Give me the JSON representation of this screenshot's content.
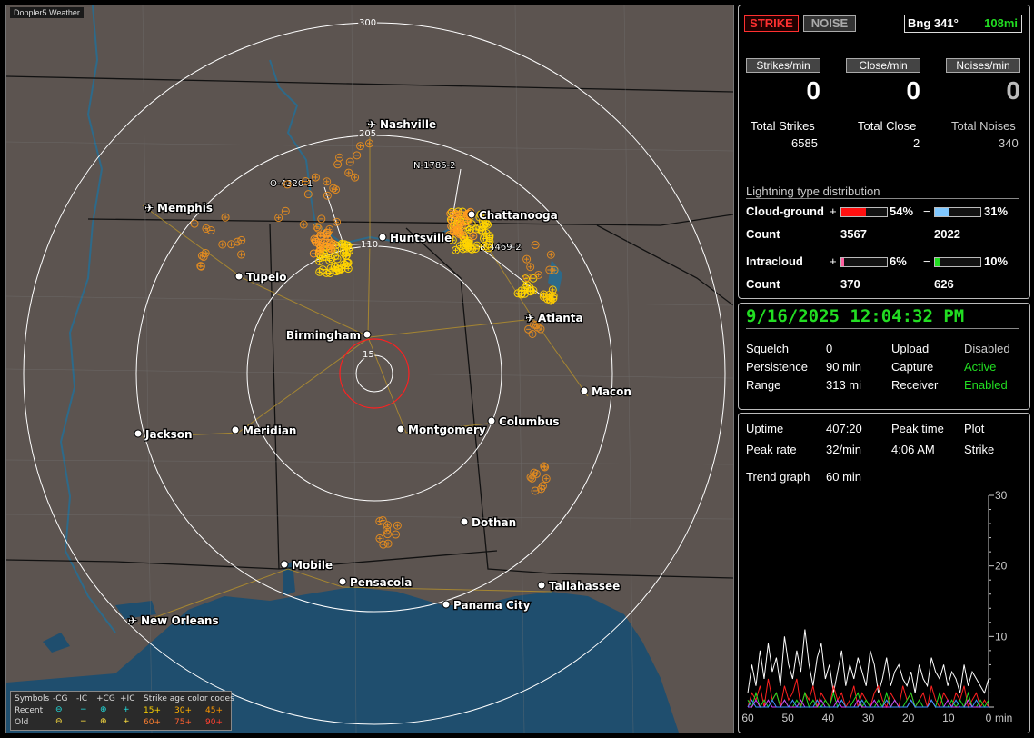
{
  "app_tag": "Doppler5 Weather",
  "map": {
    "ring_labels": [
      "300",
      "205",
      "110",
      "15"
    ],
    "cities": [
      "Nashville",
      "Memphis",
      "Chattanooga",
      "Huntsville",
      "Tupelo",
      "Birmingham",
      "Atlanta",
      "Macon",
      "Jackson",
      "Meridian",
      "Montgomery",
      "Columbus",
      "Dothan",
      "Mobile",
      "Pensacola",
      "Tallahassee",
      "Panama City",
      "New Orleans"
    ],
    "storm_labels": [
      "N-1786-2",
      "O-4320-1",
      "R-4469-2"
    ],
    "colors": {
      "land": "#5c5450",
      "water": "#1f4e6e",
      "rings": "#ffffff",
      "close_ring": "#ff2020",
      "recent": "#ffd400",
      "old": "#e08a20"
    }
  },
  "legend": {
    "symbols_title": "Symbols",
    "headers": [
      "-CG",
      "-IC",
      "+CG",
      "+IC"
    ],
    "recent_label": "Recent",
    "old_label": "Old",
    "age_title": "Strike age color codes",
    "recent_ages": [
      "15+",
      "30+",
      "45+"
    ],
    "old_ages": [
      "60+",
      "75+",
      "90+"
    ]
  },
  "panel1": {
    "strike_tab": "STRIKE",
    "noise_tab": "NOISE",
    "bearing": "Bng 341°",
    "distance": "108mi",
    "rate_buttons": [
      "Strikes/min",
      "Close/min",
      "Noises/min"
    ],
    "rate_values": [
      "0",
      "0",
      "0"
    ],
    "totals_labels": [
      "Total Strikes",
      "Total Close",
      "Total Noises"
    ],
    "totals_values": [
      "6585",
      "2",
      "340"
    ],
    "dist_title": "Lightning type distribution",
    "cg_label": "Cloud-ground",
    "cg_pos_pct": "54%",
    "cg_neg_pct": "31%",
    "cg_pos_fill": 0.54,
    "cg_neg_fill": 0.31,
    "count_label": "Count",
    "cg_pos_count": "3567",
    "cg_neg_count": "2022",
    "ic_label": "Intracloud",
    "ic_pos_pct": "6%",
    "ic_neg_pct": "10%",
    "ic_pos_fill": 0.06,
    "ic_neg_fill": 0.1,
    "ic_pos_count": "370",
    "ic_neg_count": "626"
  },
  "panel2": {
    "datetime": "9/16/2025 12:04:32 PM",
    "squelch_label": "Squelch",
    "squelch_value": "0",
    "upload_label": "Upload",
    "upload_value": "Disabled",
    "persistence_label": "Persistence",
    "persistence_value": "90 min",
    "capture_label": "Capture",
    "capture_value": "Active",
    "range_label": "Range",
    "range_value": "313 mi",
    "receiver_label": "Receiver",
    "receiver_value": "Enabled"
  },
  "panel3": {
    "uptime_label": "Uptime",
    "uptime_value": "407:20",
    "peak_time_label": "Peak time",
    "plot_label": "Plot",
    "peak_rate_label": "Peak rate",
    "peak_rate_value": "32/min",
    "peak_time_value": "4:06 AM",
    "plot_value": "Strike",
    "trend_label": "Trend graph",
    "trend_value": "60 min",
    "x_ticks": [
      "60",
      "50",
      "40",
      "30",
      "20",
      "10",
      "0"
    ],
    "x_unit": "min",
    "y_ticks": [
      "30",
      "20",
      "10"
    ]
  },
  "chart_data": {
    "type": "line",
    "xlabel": "min",
    "ylim": [
      0,
      30
    ],
    "xlim": [
      60,
      0
    ],
    "series": [
      {
        "color": "#ffffff",
        "values": [
          2,
          6,
          3,
          8,
          4,
          9,
          5,
          7,
          3,
          10,
          6,
          4,
          8,
          5,
          11,
          6,
          3,
          7,
          9,
          4,
          6,
          2,
          5,
          8,
          3,
          6,
          4,
          7,
          5,
          3,
          8,
          6,
          2,
          4,
          7,
          3,
          5,
          6,
          4,
          3,
          5,
          2,
          6,
          4,
          3,
          7,
          5,
          4,
          6,
          3,
          5,
          4,
          2,
          6,
          3,
          5,
          4,
          3,
          2,
          4
        ]
      },
      {
        "color": "#ff2020",
        "values": [
          0,
          2,
          1,
          3,
          0,
          4,
          1,
          2,
          0,
          3,
          1,
          2,
          4,
          0,
          2,
          1,
          3,
          0,
          2,
          1,
          0,
          3,
          1,
          2,
          0,
          1,
          3,
          0,
          2,
          1,
          0,
          2,
          3,
          1,
          0,
          2,
          1,
          0,
          3,
          1,
          2,
          0,
          1,
          2,
          0,
          3,
          1,
          0,
          2,
          1,
          0,
          2,
          1,
          3,
          0,
          1,
          2,
          0,
          1,
          0
        ]
      },
      {
        "color": "#22dd22",
        "values": [
          1,
          0,
          2,
          0,
          1,
          0,
          1,
          2,
          0,
          1,
          0,
          0,
          1,
          0,
          2,
          0,
          1,
          0,
          0,
          1,
          0,
          2,
          0,
          1,
          0,
          0,
          1,
          2,
          0,
          1,
          0,
          0,
          1,
          0,
          2,
          0,
          1,
          0,
          0,
          1,
          2,
          0,
          1,
          0,
          0,
          1,
          0,
          2,
          0,
          0,
          1,
          0,
          1,
          0,
          2,
          0,
          0,
          1,
          0,
          1
        ]
      },
      {
        "color": "#d040ff",
        "values": [
          0,
          0,
          1,
          0,
          0,
          1,
          0,
          0,
          0,
          1,
          0,
          0,
          0,
          1,
          0,
          0,
          0,
          0,
          1,
          0,
          0,
          0,
          1,
          0,
          0,
          0,
          0,
          1,
          0,
          0,
          0,
          1,
          0,
          0,
          0,
          0,
          1,
          0,
          0,
          0,
          1,
          0,
          0,
          0,
          0,
          1,
          0,
          0,
          0,
          1,
          0,
          0,
          0,
          0,
          1,
          0,
          0,
          0,
          0,
          0
        ]
      },
      {
        "color": "#4090ff",
        "values": [
          0,
          1,
          0,
          0,
          0,
          0,
          1,
          0,
          0,
          0,
          0,
          1,
          0,
          0,
          0,
          0,
          0,
          1,
          0,
          0,
          0,
          0,
          0,
          1,
          0,
          0,
          0,
          0,
          1,
          0,
          0,
          0,
          0,
          0,
          1,
          0,
          0,
          0,
          0,
          0,
          1,
          0,
          0,
          0,
          0,
          1,
          0,
          0,
          0,
          0,
          0,
          1,
          0,
          0,
          0,
          0,
          1,
          0,
          0,
          0
        ]
      }
    ]
  }
}
